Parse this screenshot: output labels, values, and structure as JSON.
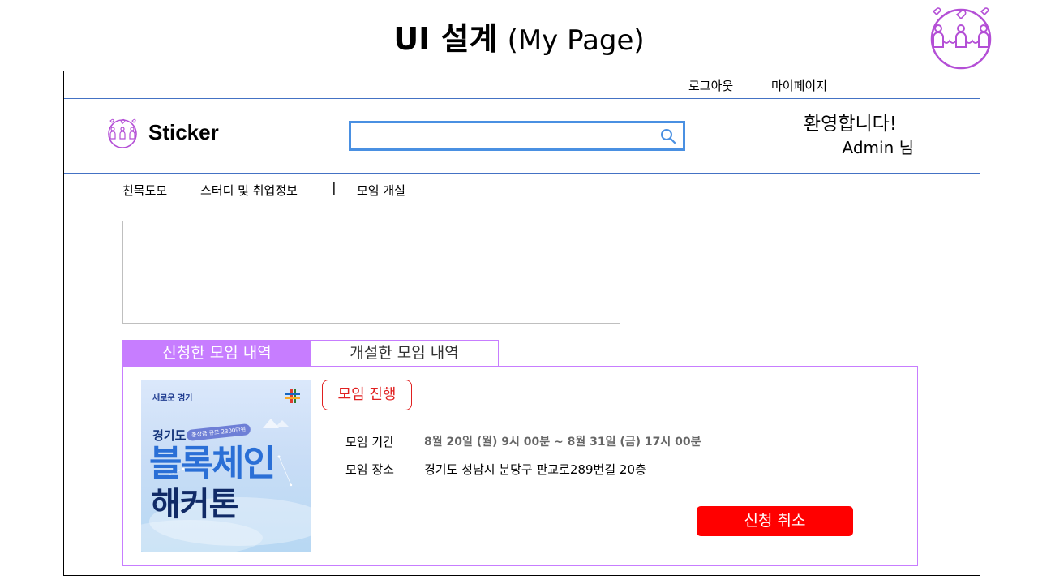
{
  "slide": {
    "title_main": "UI 설계",
    "title_sub": "(My Page)"
  },
  "topbar": {
    "logout": "로그아웃",
    "mypage": "마이페이지"
  },
  "header": {
    "site_name": "Sticker",
    "search": {
      "value": "",
      "placeholder": ""
    },
    "welcome": "환영합니다!",
    "user": "Admin 님"
  },
  "nav": {
    "items": [
      "친목도모",
      "스터디 및 취업정보",
      "모임 개설"
    ],
    "separator": "|"
  },
  "tabs": [
    {
      "label": "신청한 모임 내역",
      "active": true
    },
    {
      "label": "개설한 모임 내역",
      "active": false
    }
  ],
  "meeting": {
    "status": "모임 진행",
    "period_label": "모임 기간",
    "period_value": "8월 20일 (월) 9시 00분 ~ 8월 31일 (금) 17시 00분",
    "place_label": "모임 장소",
    "place_value": "경기도 성남시 분당구 판교로289번길 20층",
    "cancel_label": "신청 취소",
    "poster": {
      "tag": "새로운 경기",
      "badge": "총상금 규모 2300만원",
      "line1": "경기도",
      "line2": "블록체인",
      "line3": "해커톤"
    }
  },
  "colors": {
    "accent_purple": "#c77dff",
    "search_border": "#4a90e2",
    "cancel_red": "#ff0000",
    "status_red": "#e02020",
    "rule_blue": "#4472c4"
  },
  "icons": {
    "brand": "friends-hearts-icon",
    "search": "search-icon"
  }
}
